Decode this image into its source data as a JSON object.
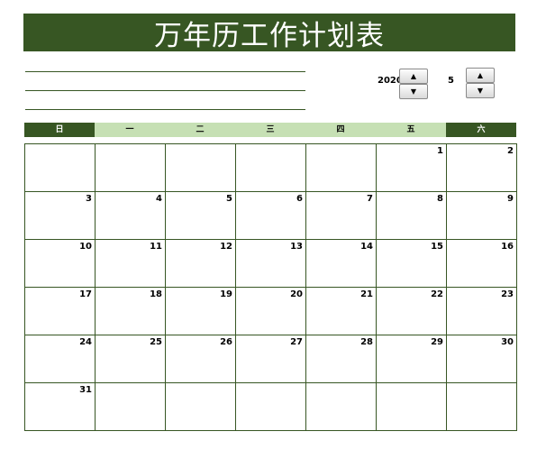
{
  "title": "万年历工作计划表",
  "controls": {
    "year": "2020",
    "month": "5",
    "up_icon": "▲",
    "down_icon": "▼"
  },
  "weekdays": [
    "日",
    "一",
    "二",
    "三",
    "四",
    "五",
    "六"
  ],
  "weeks": [
    [
      "",
      "",
      "",
      "",
      "",
      "1",
      "2"
    ],
    [
      "3",
      "4",
      "5",
      "6",
      "7",
      "8",
      "9"
    ],
    [
      "10",
      "11",
      "12",
      "13",
      "14",
      "15",
      "16"
    ],
    [
      "17",
      "18",
      "19",
      "20",
      "21",
      "22",
      "23"
    ],
    [
      "24",
      "25",
      "26",
      "27",
      "28",
      "29",
      "30"
    ],
    [
      "31",
      "",
      "",
      "",
      "",
      "",
      ""
    ]
  ],
  "colors": {
    "header_dark_green": "#375623",
    "weekday_light_green": "#c6e0b4"
  }
}
